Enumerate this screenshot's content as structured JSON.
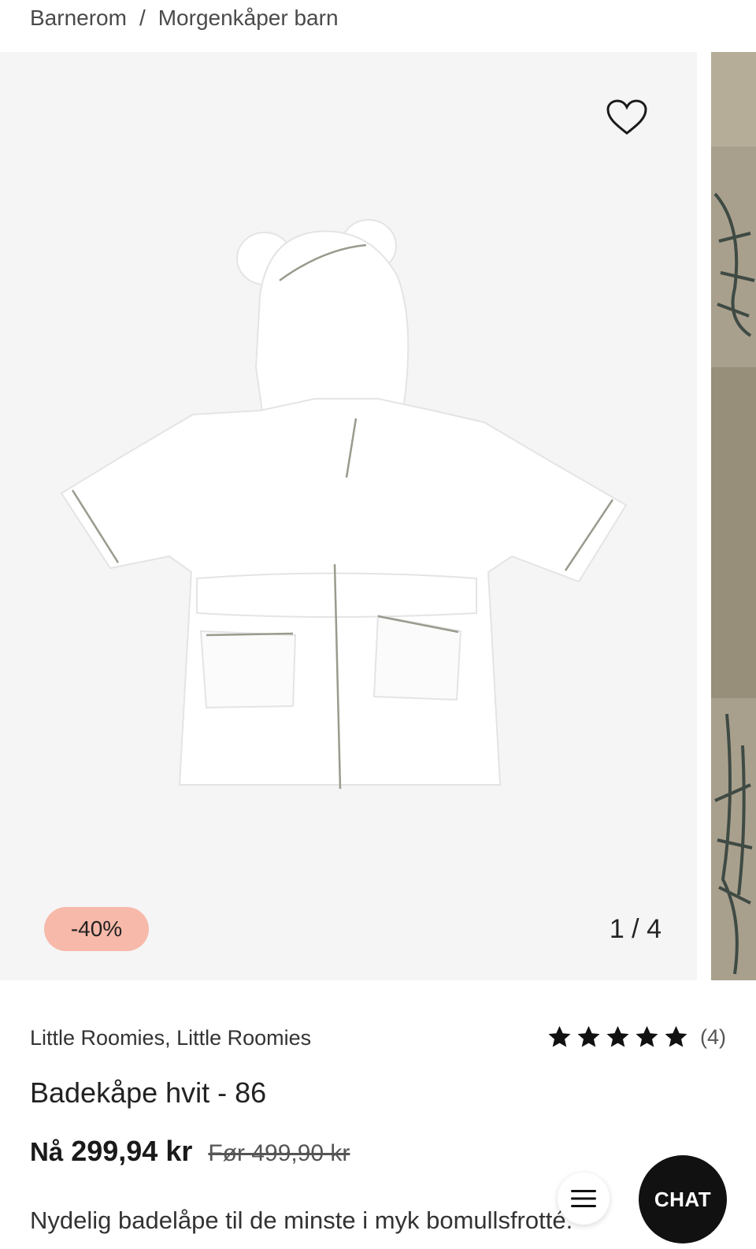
{
  "breadcrumb": {
    "items": [
      "Barnerom",
      "Morgenkåper barn"
    ],
    "separator": "/"
  },
  "gallery": {
    "counter": "1 / 4",
    "discount_badge": "-40%",
    "favorite_icon": "heart-outline-icon",
    "image_subject": "product-photo"
  },
  "product": {
    "brand": "Little Roomies, Little Roomies",
    "title": "Badekåpe hvit - 86",
    "rating": {
      "stars": 5,
      "count_label": "(4)"
    },
    "price": {
      "now_prefix": "Nå",
      "now_value": "299,94 kr",
      "old_label": "Før 499,90 kr"
    },
    "description": "Nydelig badelåpe til de minste i myk bomullsfrotté."
  },
  "floating": {
    "menu_icon": "hamburger-icon",
    "chat_label": "CHAT"
  },
  "colors": {
    "badge_bg": "#f7b9aa",
    "chat_bg": "#111111",
    "image_bg": "#f5f5f5"
  }
}
